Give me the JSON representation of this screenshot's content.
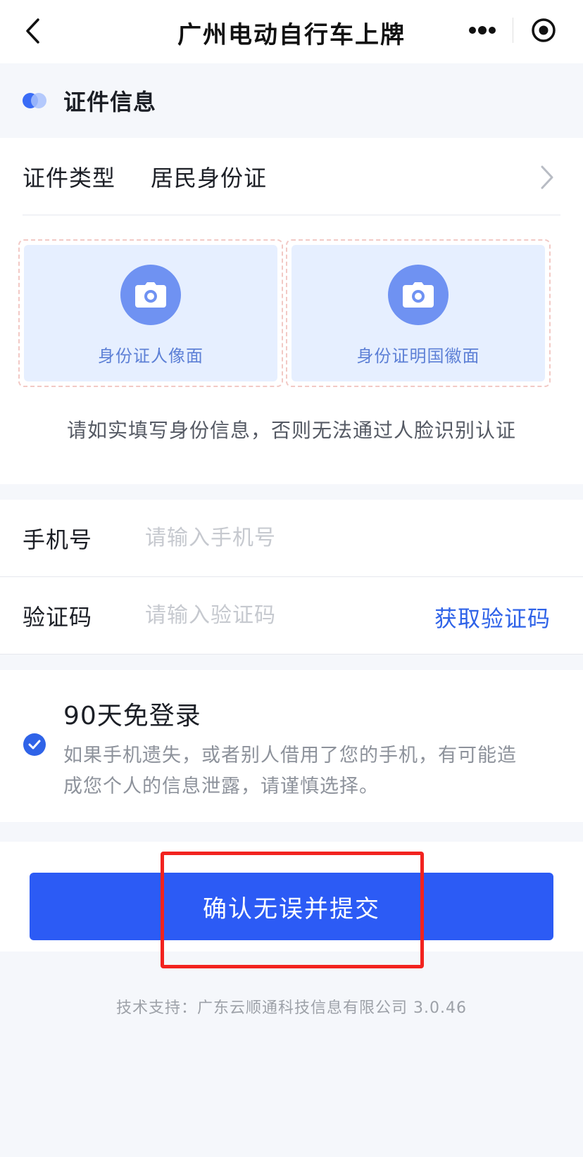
{
  "navbar": {
    "title": "广州电动自行车上牌",
    "back_icon": "chevron-left-icon",
    "more_icon": "more-dots-icon",
    "close_icon": "target-close-icon"
  },
  "section": {
    "title": "证件信息"
  },
  "id_card": {
    "type_label": "证件类型",
    "type_value": "居民身份证",
    "front_label": "身份证人像面",
    "back_label": "身份证明国徽面",
    "notice": "请如实填写身份信息，否则无法通过人脸识别认证"
  },
  "form": {
    "phone_label": "手机号",
    "phone_placeholder": "请输入手机号",
    "code_label": "验证码",
    "code_placeholder": "请输入验证码",
    "get_code": "获取验证码"
  },
  "remember": {
    "checked": true,
    "title": "90天免登录",
    "desc": "如果手机遗失，或者别人借用了您的手机，有可能造成您个人的信息泄露，请谨慎选择。"
  },
  "submit": {
    "label": "确认无误并提交"
  },
  "footer": {
    "text": "技术支持：广东云顺通科技信息有限公司 3.0.46"
  },
  "colors": {
    "primary": "#2c5bf5",
    "link": "#2f63e8",
    "highlight": "#f2231f",
    "upload_bg": "#e6efff"
  }
}
